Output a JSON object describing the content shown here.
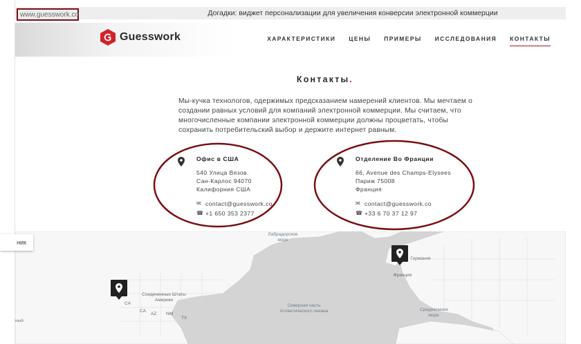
{
  "browser": {
    "url": "www.guesswork.co",
    "title": "Догадки: виджет персонализации для увеличения конверсии электронной коммерции"
  },
  "header": {
    "logo_text": "Guesswork",
    "nav": [
      {
        "label": "ХАРАКТЕРИСТИКИ",
        "active": false
      },
      {
        "label": "ЦЕНЫ",
        "active": false
      },
      {
        "label": "ПРИМЕРЫ",
        "active": false
      },
      {
        "label": "ИССЛЕДОВАНИЯ",
        "active": false
      },
      {
        "label": "КОНТАКТЫ",
        "active": true
      }
    ]
  },
  "main": {
    "title": "Контакты",
    "title_dot": ".",
    "intro": "Мы-кучка технологов, одержимых предсказанием намерений клиентов. Мы мечтаем о создании равных условий для компаний электронной коммерции. Мы считаем, что многочисленные компании электронной коммерции должны процветать, чтобы сохранить потребительский выбор и держите интернет равным."
  },
  "offices": {
    "us": {
      "name": "Офис в США",
      "line1": "540 Улица Вязов.",
      "line2": "Сан-Карлос 94070",
      "line3": "Калифорния США",
      "email": "contact@guesswork.co",
      "phone": "+1 650 353 2377"
    },
    "fr": {
      "name": "Отделение Во Франции",
      "line1": "66, Avenue des Champs-Elysees",
      "line2": "Париж 75008",
      "line3": "Франция",
      "email": "contact@guesswork.co",
      "phone": "+33 6 70 37 12 97"
    }
  },
  "map": {
    "button_label": "ник",
    "labels": {
      "labrador": "Лабрадорское море",
      "usa": "Соединенные Штаты Америки",
      "atlantic": "Северная часть Атлантического океана",
      "france": "Франция",
      "germany": "Германия",
      "mediterranean": "Средиземное море",
      "ca": "CA",
      "az": "AZ",
      "nm": "NM",
      "tx": "TX",
      "pacific": "ный"
    }
  },
  "colors": {
    "accent": "#d1222b",
    "annotation": "#7a0e14",
    "map_bg": "#d4d4d4"
  }
}
